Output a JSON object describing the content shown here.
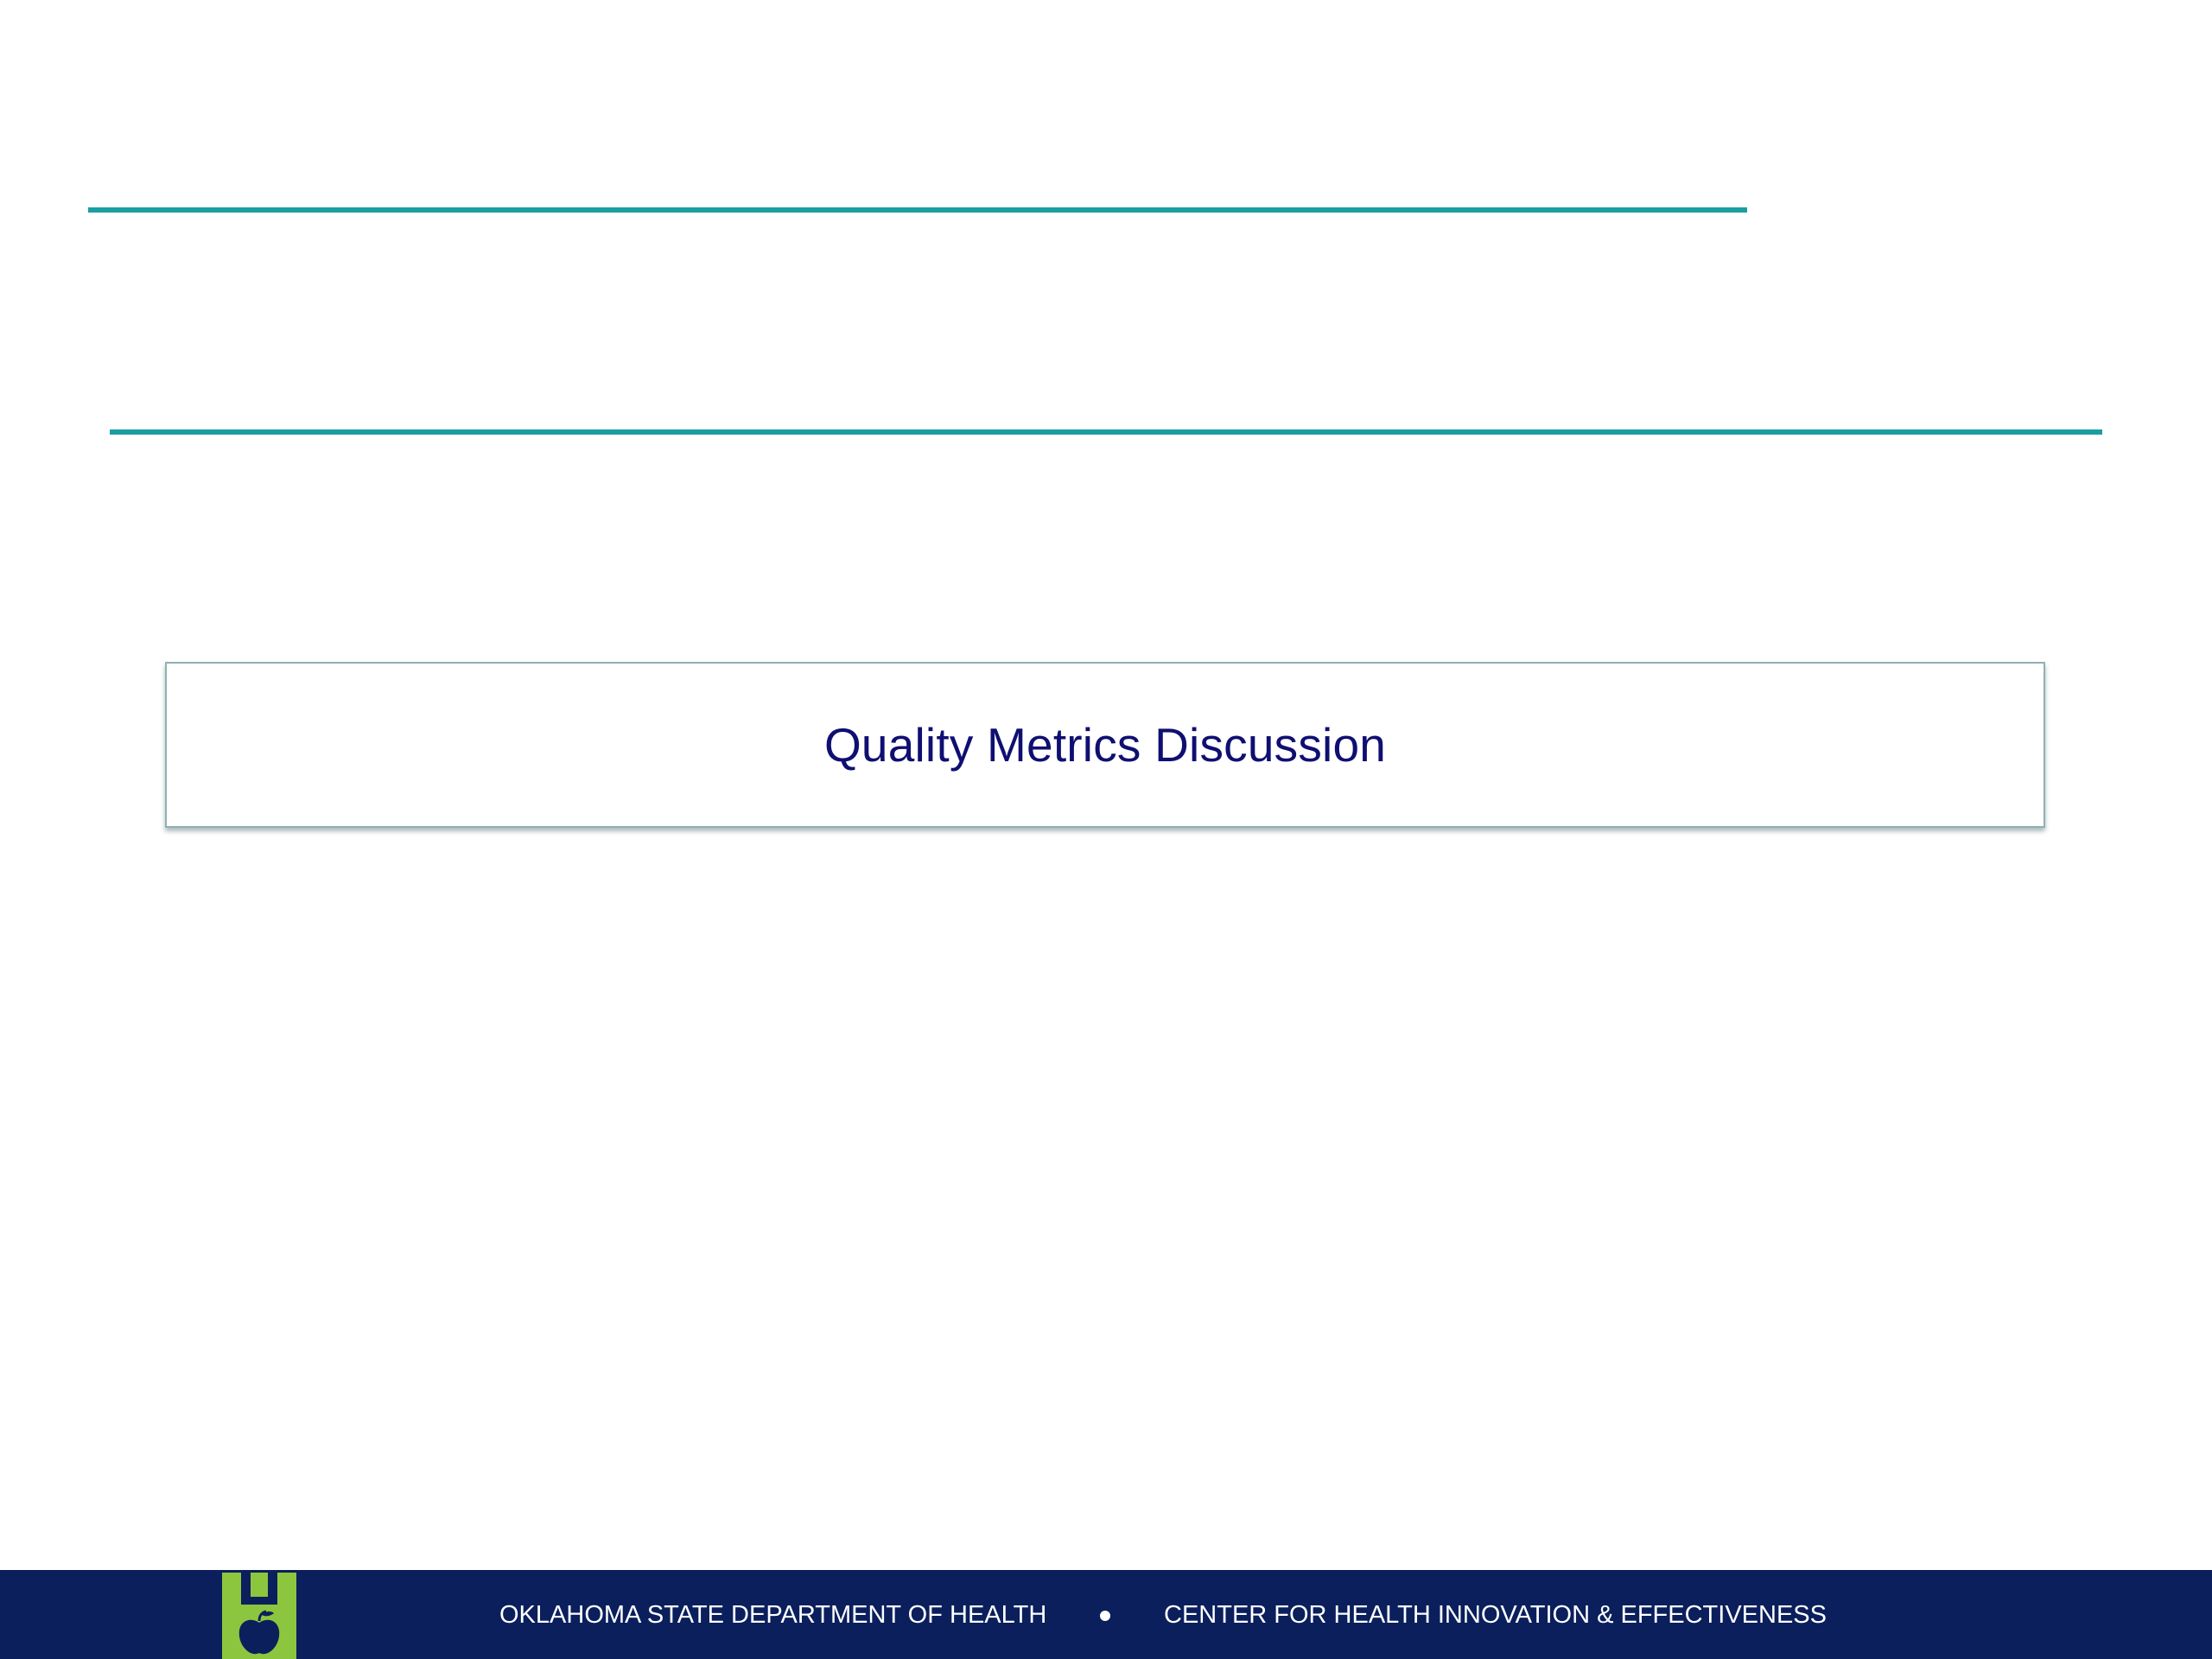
{
  "slide": {
    "title": "Quality Metrics Discussion"
  },
  "footer": {
    "organization": "OKLAHOMA STATE DEPARTMENT OF HEALTH",
    "center": "CENTER FOR HEALTH INNOVATION & EFFECTIVENESS",
    "logo_icon": "apple-in-h-logo-icon"
  },
  "colors": {
    "accent_teal": "#1a9ea3",
    "title_navy": "#0f0f72",
    "footer_navy": "#0a1f5c",
    "logo_green": "#8cc63f"
  }
}
